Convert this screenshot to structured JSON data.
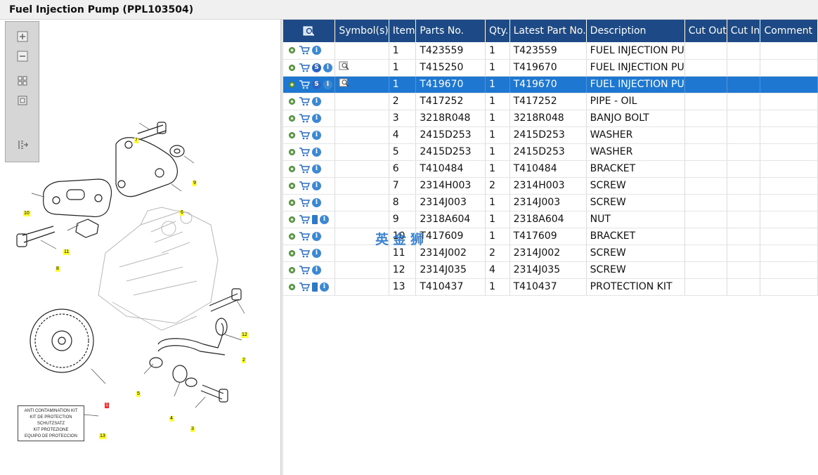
{
  "window": {
    "title": "Fuel Injection Pump (PPL103504)"
  },
  "toolbar": {
    "buttons": [
      {
        "name": "zoom-in-button",
        "icon": "zoom-in-icon"
      },
      {
        "name": "zoom-out-button",
        "icon": "zoom-out-icon"
      },
      {
        "name": "fit-all-button",
        "icon": "grid-icon"
      },
      {
        "name": "fit-window-button",
        "icon": "square-icon"
      },
      {
        "name": "export-button",
        "icon": "export-icon"
      }
    ]
  },
  "diagram": {
    "callouts": [
      "7",
      "9",
      "6",
      "10",
      "11",
      "8",
      "12",
      "2",
      "5",
      "4",
      "3",
      "1",
      "13"
    ],
    "anti_contamination_kit": [
      "ANTI CONTAMINATION KIT",
      "KIT DE PROTECTION",
      "SCHUTZSATZ",
      "KIT PROTEZIONE",
      "EQUIPO DE PROTECCION"
    ]
  },
  "table": {
    "headers": {
      "icon": "search-icon",
      "symbols": "Symbol(s)",
      "item": "Item",
      "parts_no": "Parts No.",
      "qty": "Qty.",
      "latest": "Latest Part No.",
      "description": "Description",
      "cut_out": "Cut Out",
      "cut_in": "Cut In",
      "comment": "Comment"
    },
    "rows": [
      {
        "item": "1",
        "parts_no": "T423559",
        "qty": "1",
        "latest": "T423559",
        "description": "FUEL INJECTION PU",
        "cut_out": "",
        "cut_in": "",
        "comment": ""
      },
      {
        "item": "1",
        "parts_no": "T415250",
        "qty": "1",
        "latest": "T419670",
        "description": "FUEL INJECTION PU",
        "cut_out": "",
        "cut_in": "",
        "comment": ""
      },
      {
        "item": "1",
        "parts_no": "T419670",
        "qty": "1",
        "latest": "T419670",
        "description": "FUEL INJECTION PU",
        "cut_out": "",
        "cut_in": "",
        "comment": ""
      },
      {
        "item": "2",
        "parts_no": "T417252",
        "qty": "1",
        "latest": "T417252",
        "description": "PIPE - OIL",
        "cut_out": "",
        "cut_in": "",
        "comment": ""
      },
      {
        "item": "3",
        "parts_no": "3218R048",
        "qty": "1",
        "latest": "3218R048",
        "description": "BANJO BOLT",
        "cut_out": "",
        "cut_in": "",
        "comment": ""
      },
      {
        "item": "4",
        "parts_no": "2415D253",
        "qty": "1",
        "latest": "2415D253",
        "description": "WASHER",
        "cut_out": "",
        "cut_in": "",
        "comment": ""
      },
      {
        "item": "5",
        "parts_no": "2415D253",
        "qty": "1",
        "latest": "2415D253",
        "description": "WASHER",
        "cut_out": "",
        "cut_in": "",
        "comment": ""
      },
      {
        "item": "6",
        "parts_no": "T410484",
        "qty": "1",
        "latest": "T410484",
        "description": "BRACKET",
        "cut_out": "",
        "cut_in": "",
        "comment": ""
      },
      {
        "item": "7",
        "parts_no": "2314H003",
        "qty": "2",
        "latest": "2314H003",
        "description": "SCREW",
        "cut_out": "",
        "cut_in": "",
        "comment": ""
      },
      {
        "item": "8",
        "parts_no": "2314J003",
        "qty": "1",
        "latest": "2314J003",
        "description": "SCREW",
        "cut_out": "",
        "cut_in": "",
        "comment": ""
      },
      {
        "item": "9",
        "parts_no": "2318A604",
        "qty": "1",
        "latest": "2318A604",
        "description": "NUT",
        "cut_out": "",
        "cut_in": "",
        "comment": ""
      },
      {
        "item": "10",
        "parts_no": "T417609",
        "qty": "1",
        "latest": "T417609",
        "description": "BRACKET",
        "cut_out": "",
        "cut_in": "",
        "comment": ""
      },
      {
        "item": "11",
        "parts_no": "2314J002",
        "qty": "2",
        "latest": "2314J002",
        "description": "SCREW",
        "cut_out": "",
        "cut_in": "",
        "comment": ""
      },
      {
        "item": "12",
        "parts_no": "2314J035",
        "qty": "4",
        "latest": "2314J035",
        "description": "SCREW",
        "cut_out": "",
        "cut_in": "",
        "comment": ""
      },
      {
        "item": "13",
        "parts_no": "T410437",
        "qty": "1",
        "latest": "T410437",
        "description": "PROTECTION KIT",
        "cut_out": "",
        "cut_in": "",
        "comment": ""
      }
    ]
  },
  "watermark": {
    "text": "英金狮"
  }
}
